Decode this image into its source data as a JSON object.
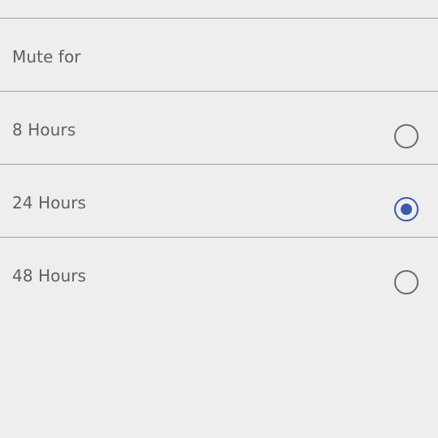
{
  "dialog": {
    "title": "Mute for",
    "options": [
      {
        "label": "8 Hours",
        "selected": false
      },
      {
        "label": "24 Hours",
        "selected": true
      },
      {
        "label": "48 Hours",
        "selected": false
      }
    ]
  },
  "colors": {
    "background": "#eeeeee",
    "divider": "#9e9e9e",
    "text": "#5f5f5f",
    "radio_unchecked": "#6b6b6b",
    "radio_checked": "#3b5ba8"
  }
}
